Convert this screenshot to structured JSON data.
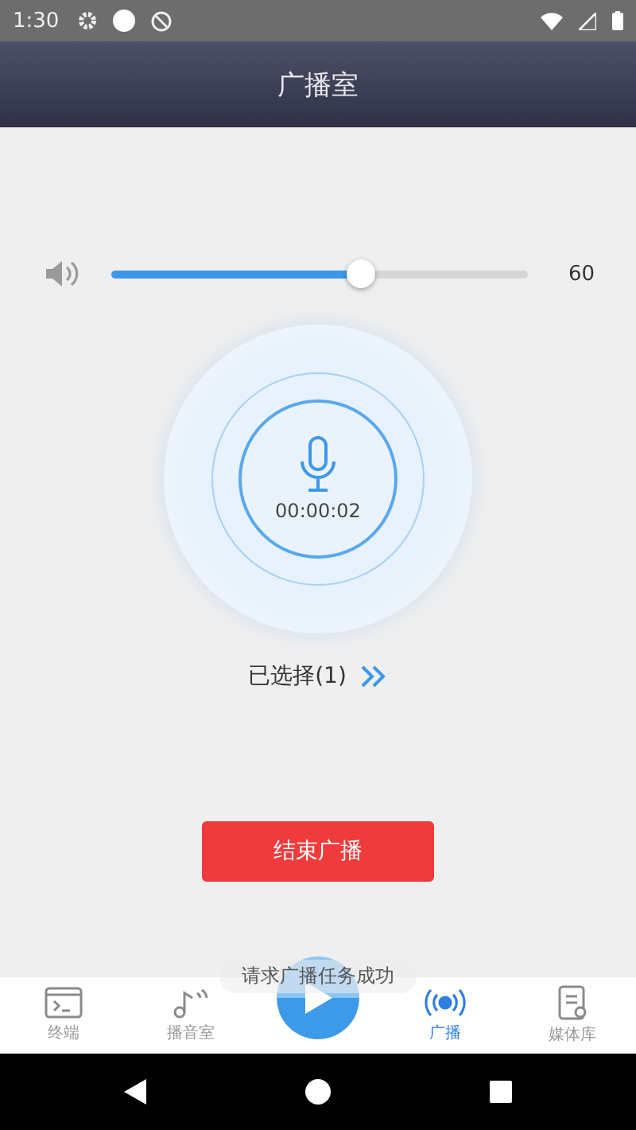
{
  "status_bar": {
    "time": "1:30"
  },
  "title": "广播室",
  "volume": {
    "level": 0.6,
    "reading": "60"
  },
  "recorder": {
    "timer": "00:00:02"
  },
  "selection": {
    "label": "已选择(1)"
  },
  "end_button": {
    "label": "结束广播"
  },
  "toast": "请求广播任务成功",
  "tabs": [
    {
      "kind": "terminal",
      "label": "终端",
      "selected": false
    },
    {
      "kind": "studio",
      "label": "播音室",
      "selected": false
    },
    {
      "kind": "play"
    },
    {
      "kind": "broadcast",
      "label": "广播",
      "selected": true
    },
    {
      "kind": "media",
      "label": "媒体库",
      "selected": false
    }
  ]
}
